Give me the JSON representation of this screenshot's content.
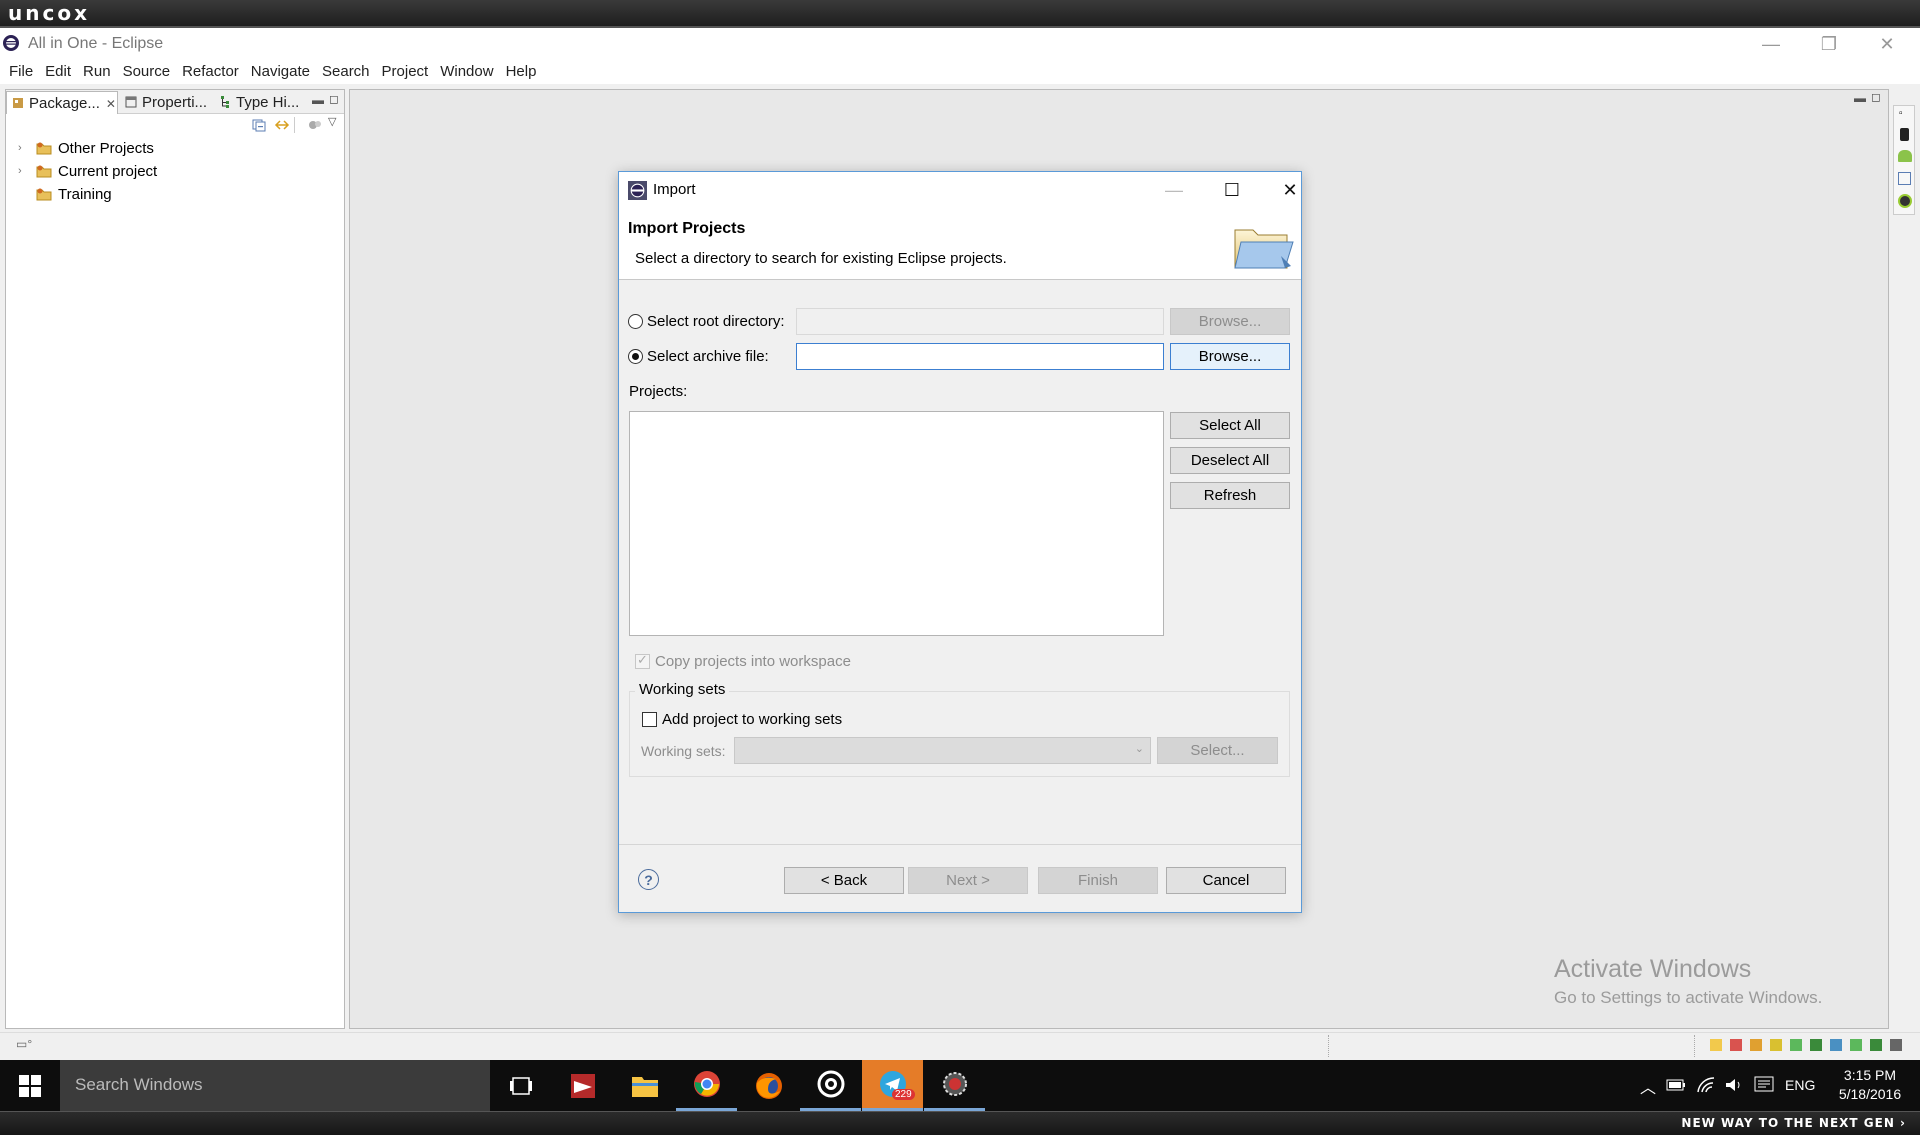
{
  "watermark": {
    "logo": "uncox",
    "slogan": "NEW WAY TO THE NEXT GEN ›"
  },
  "window": {
    "title": "All in One - Eclipse"
  },
  "menu": [
    "File",
    "Edit",
    "Run",
    "Source",
    "Refactor",
    "Navigate",
    "Search",
    "Project",
    "Window",
    "Help"
  ],
  "left_view": {
    "tabs": [
      {
        "label": "Package...",
        "icon": "package-explorer-icon"
      },
      {
        "label": "Properti...",
        "icon": "properties-icon"
      },
      {
        "label": "Type Hi...",
        "icon": "type-hierarchy-icon"
      }
    ],
    "tree": [
      {
        "label": "Other Projects",
        "expandable": true
      },
      {
        "label": "Current project",
        "expandable": true
      },
      {
        "label": "Training",
        "expandable": false
      }
    ]
  },
  "dialog": {
    "title": "Import",
    "header_title": "Import Projects",
    "header_desc": "Select a directory to search for existing Eclipse projects.",
    "root_dir_label": "Select root directory:",
    "archive_label": "Select archive file:",
    "root_dir_value": "",
    "archive_value": "",
    "browse_label": "Browse...",
    "projects_label": "Projects:",
    "select_all": "Select All",
    "deselect_all": "Deselect All",
    "refresh": "Refresh",
    "copy_label": "Copy projects into workspace",
    "working_sets_group": "Working sets",
    "add_working_sets": "Add project to working sets",
    "working_sets_label": "Working sets:",
    "select_btn": "Select...",
    "back": "< Back",
    "next": "Next >",
    "finish": "Finish",
    "cancel": "Cancel"
  },
  "activate_windows": {
    "title": "Activate Windows",
    "subtitle": "Go to Settings to activate Windows."
  },
  "taskbar": {
    "search_placeholder": "Search Windows",
    "apps": [
      "task-view-icon",
      "winrar-icon",
      "file-explorer-icon",
      "chrome-icon",
      "firefox-icon",
      "media-player-icon",
      "telegram-icon",
      "eclipse-icon"
    ],
    "telegram_badge": "229",
    "language": "ENG",
    "time": "3:15 PM",
    "date": "5/18/2016"
  },
  "colors": {
    "dialog_border": "#5a9ad8",
    "taskbar": "#0d0d0d",
    "telegram_active": "#e57c28"
  }
}
